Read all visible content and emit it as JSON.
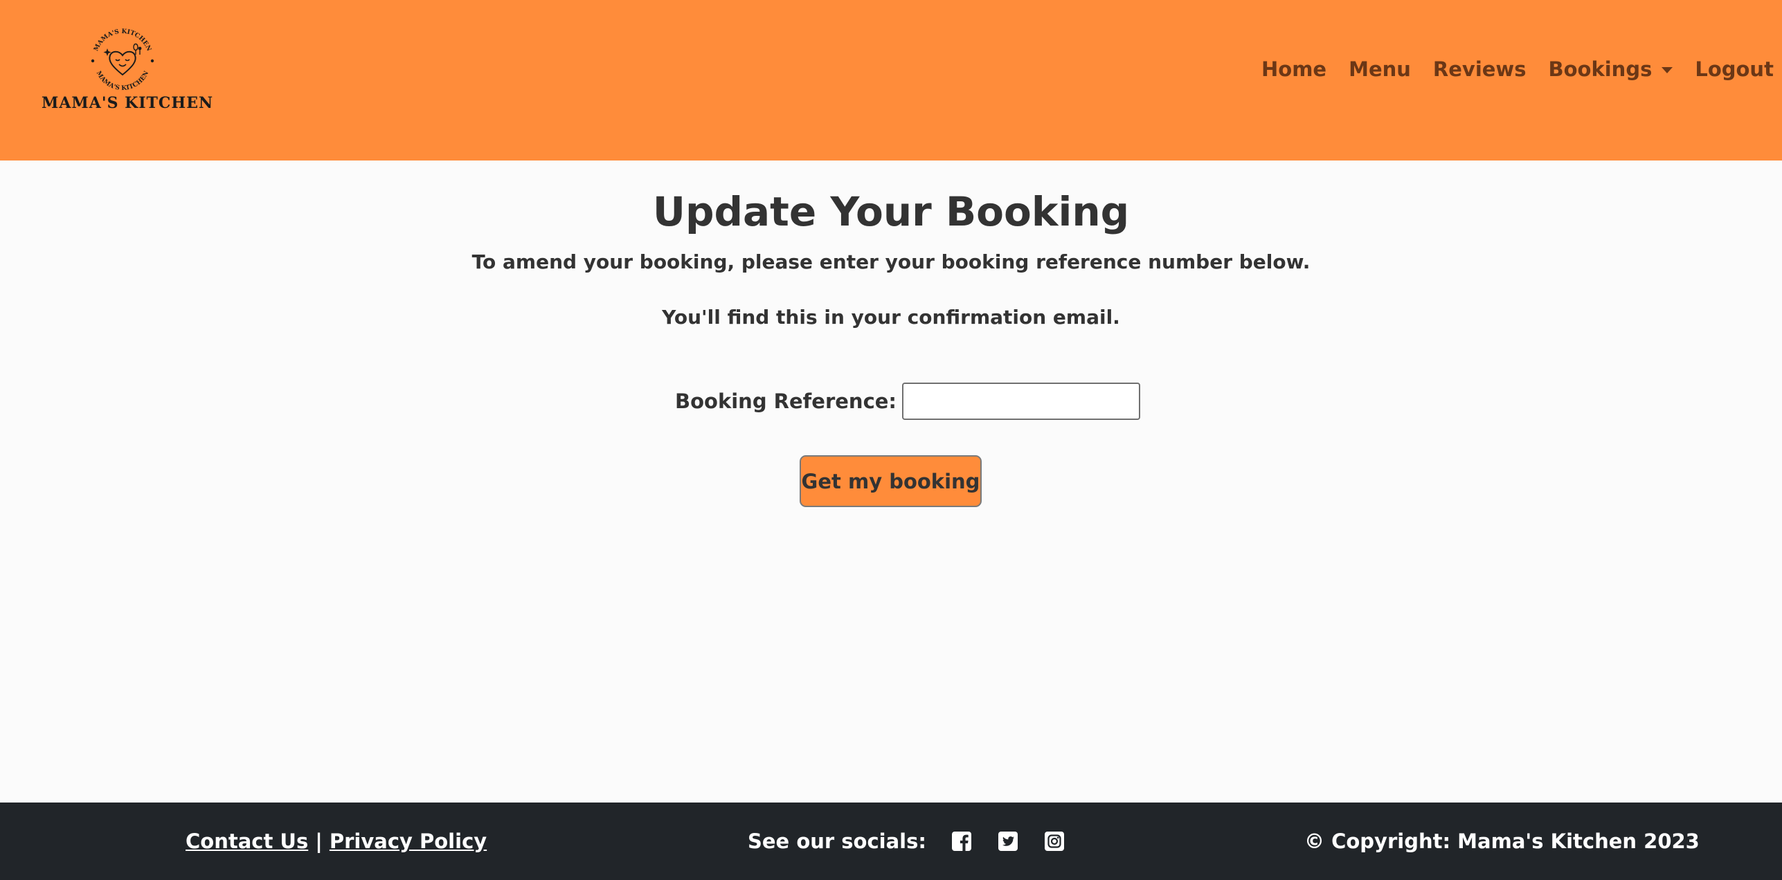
{
  "brand": {
    "name": "MAMA'S KITCHEN",
    "badge_text": "MAMA'S KITCHEN"
  },
  "nav": {
    "items": [
      {
        "label": "Home"
      },
      {
        "label": "Menu"
      },
      {
        "label": "Reviews"
      },
      {
        "label": "Bookings"
      },
      {
        "label": "Logout"
      }
    ]
  },
  "main": {
    "title": "Update Your Booking",
    "paragraph1": "To amend your booking, please enter your booking reference number below.",
    "paragraph2": "You'll find this in your confirmation email.",
    "form": {
      "label": "Booking Reference:",
      "value": "",
      "placeholder": ""
    },
    "submit_label": "Get my booking"
  },
  "footer": {
    "contact_label": "Contact Us",
    "separator": "|",
    "privacy_label": "Privacy Policy",
    "socials_label": "See our socials:",
    "social_icons": [
      "facebook-icon",
      "twitter-icon",
      "instagram-icon"
    ],
    "copyright": "© Copyright: Mama's Kitchen 2023"
  },
  "colors": {
    "header_bg": "#ff8c3a",
    "nav_text": "#6b3716",
    "body_bg": "#fbfbfb",
    "text": "#333333",
    "button_bg": "#ff8c3a",
    "footer_bg": "#212529",
    "footer_text": "#ffffff"
  }
}
